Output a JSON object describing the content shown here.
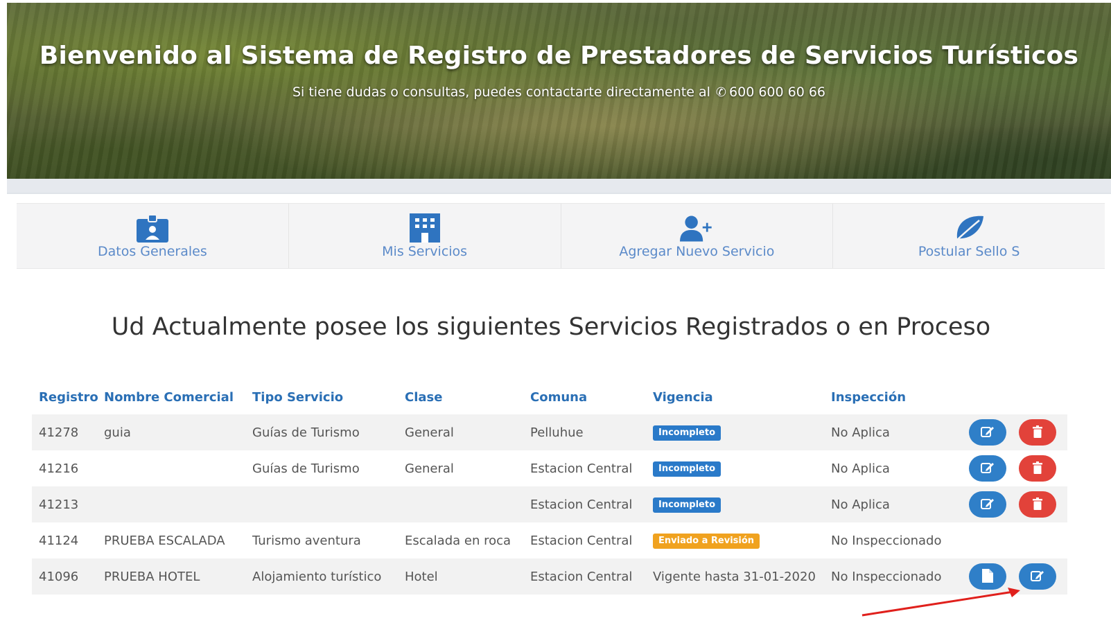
{
  "hero": {
    "title": "Bienvenido al Sistema de Registro de Prestadores de Servicios Turísticos",
    "subtitle_prefix": "Si tiene dudas o consultas, puedes contactarte directamente al",
    "phone": "600 600 60 66"
  },
  "nav": [
    {
      "label": "Datos Generales",
      "icon": "id-card-icon"
    },
    {
      "label": "Mis Servicios",
      "icon": "building-icon"
    },
    {
      "label": "Agregar Nuevo Servicio",
      "icon": "user-plus-icon"
    },
    {
      "label": "Postular Sello S",
      "icon": "leaf-icon"
    }
  ],
  "heading": "Ud Actualmente posee los siguientes Servicios Registrados o en Proceso",
  "table": {
    "headers": [
      "Registro",
      "Nombre Comercial",
      "Tipo Servicio",
      "Clase",
      "Comuna",
      "Vigencia",
      "Inspección"
    ],
    "rows": [
      {
        "registro": "41278",
        "nombre": "guia",
        "tipo": "Guías de Turismo",
        "clase": "General",
        "comuna": "Pelluhue",
        "vigencia": "Incompleto",
        "inspeccion": "No Aplica"
      },
      {
        "registro": "41216",
        "nombre": "",
        "tipo": "Guías de Turismo",
        "clase": "General",
        "comuna": "Estacion Central",
        "vigencia": "Incompleto",
        "inspeccion": "No Aplica"
      },
      {
        "registro": "41213",
        "nombre": "",
        "tipo": "",
        "clase": "",
        "comuna": "Estacion Central",
        "vigencia": "Incompleto",
        "inspeccion": "No Aplica"
      },
      {
        "registro": "41124",
        "nombre": "PRUEBA ESCALADA",
        "tipo": "Turismo aventura",
        "clase": "Escalada en roca",
        "comuna": "Estacion Central",
        "vigencia": "Enviado a Revisión",
        "inspeccion": "No Inspeccionado"
      },
      {
        "registro": "41096",
        "nombre": "PRUEBA HOTEL",
        "tipo": "Alojamiento turístico",
        "clase": "Hotel",
        "comuna": "Estacion Central",
        "vigencia": "Vigente hasta 31-01-2020",
        "inspeccion": "No Inspeccionado"
      }
    ]
  },
  "colors": {
    "header_text": "#2a6fb5",
    "badge_blue": "#2a7ac9",
    "badge_orange": "#f0a21f",
    "btn_blue": "#2f7fc8",
    "btn_red": "#e2423a",
    "arrow": "#e0201c"
  }
}
